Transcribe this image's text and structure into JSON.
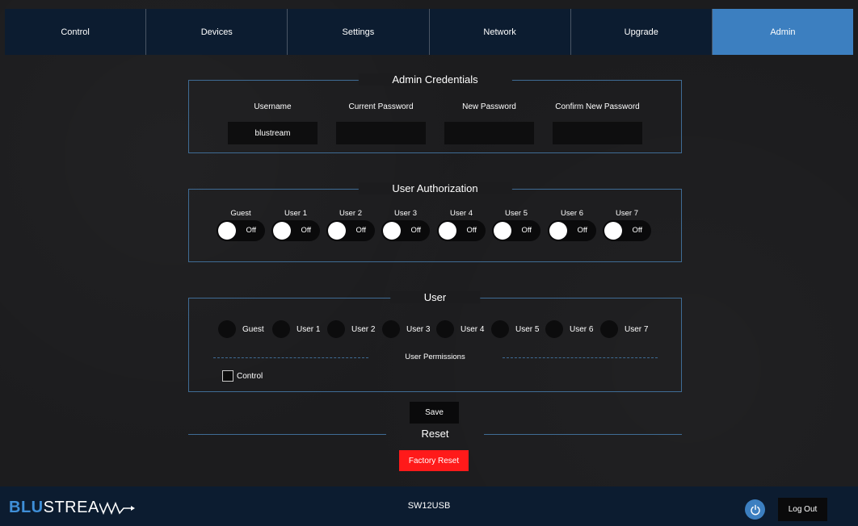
{
  "nav": {
    "tabs": [
      "Control",
      "Devices",
      "Settings",
      "Network",
      "Upgrade",
      "Admin"
    ],
    "active": "Admin"
  },
  "credentials": {
    "title": "Admin Credentials",
    "username_label": "Username",
    "username_value": "blustream",
    "current_password_label": "Current Password",
    "current_password_value": "",
    "new_password_label": "New Password",
    "new_password_value": "",
    "confirm_password_label": "Confirm New Password",
    "confirm_password_value": ""
  },
  "authorization": {
    "title": "User Authorization",
    "users": [
      {
        "label": "Guest",
        "state": "Off"
      },
      {
        "label": "User 1",
        "state": "Off"
      },
      {
        "label": "User 2",
        "state": "Off"
      },
      {
        "label": "User 3",
        "state": "Off"
      },
      {
        "label": "User 4",
        "state": "Off"
      },
      {
        "label": "User 5",
        "state": "Off"
      },
      {
        "label": "User 6",
        "state": "Off"
      },
      {
        "label": "User 7",
        "state": "Off"
      }
    ]
  },
  "user": {
    "title": "User",
    "options": [
      "Guest",
      "User 1",
      "User 2",
      "User 3",
      "User 4",
      "User 5",
      "User 6",
      "User 7"
    ],
    "permissions_title": "User Permissions",
    "permissions": [
      {
        "label": "Control",
        "checked": false
      }
    ]
  },
  "actions": {
    "save_label": "Save",
    "reset_title": "Reset",
    "factory_reset_label": "Factory Reset"
  },
  "footer": {
    "logo_blu": "BLU",
    "logo_stream": "STREA",
    "model": "SW12USB",
    "power_icon": "power-icon",
    "logout_label": "Log Out"
  },
  "colors": {
    "nav_bg": "#0c1c30",
    "accent": "#3c7fc0",
    "panel_border": "#3f6c95",
    "danger": "#ff1a1a"
  }
}
